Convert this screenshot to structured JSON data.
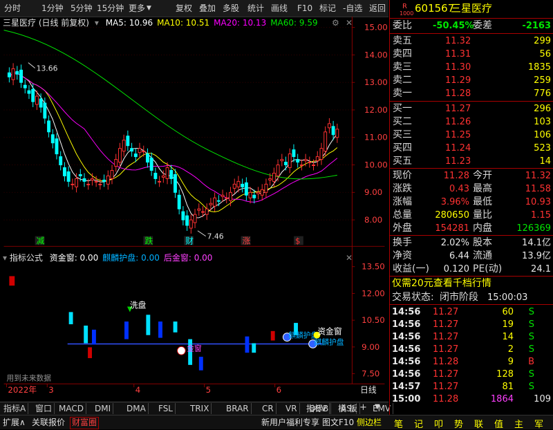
{
  "toolbar": {
    "left_items": [
      "分时",
      "1分钟",
      "5分钟",
      "15分钟",
      "更多"
    ],
    "right_items": [
      "复权",
      "叠加",
      "多股",
      "统计",
      "画线",
      "F10",
      "标记",
      "-自选",
      "返回"
    ]
  },
  "chart": {
    "title": "三星医疗 (日线 前复权)",
    "ma_labels": [
      {
        "text": "MA5: 10.96",
        "color": "#ffffff"
      },
      {
        "text": "MA10: 10.51",
        "color": "#ffff00"
      },
      {
        "text": "MA20: 10.13",
        "color": "#ff00ff"
      },
      {
        "text": "MA60: 9.59",
        "color": "#00e600"
      }
    ],
    "price_axis": [
      "15.00",
      "14.00",
      "13.00",
      "12.00",
      "11.00",
      "10.00",
      "9.00",
      "8.00"
    ],
    "high_mark": "13.66",
    "low_mark": "7.46",
    "event_labels": [
      {
        "text": "减",
        "color": "#00ff00"
      },
      {
        "text": "跌",
        "color": "#00ff00"
      },
      {
        "text": "财",
        "color": "#00ffff"
      },
      {
        "text": "涨",
        "color": "#ff4040"
      },
      {
        "text": "$",
        "color": "#ff3232"
      }
    ],
    "indicator": {
      "name": "指标公式",
      "fields": [
        {
          "text": "资金窗: 0.00",
          "color": "#ffffff"
        },
        {
          "text": "麒麟护盘: 0.00",
          "color": "#00b0ff"
        },
        {
          "text": "后金窗: 0.00",
          "color": "#ff40ff"
        }
      ],
      "axis": [
        "13.50",
        "12.00",
        "10.50",
        "9.00",
        "7.50"
      ],
      "labels": {
        "xipan": "洗盘",
        "jinchuang": "金窗",
        "zijinchuang": "资金窗",
        "qilin1": "麒麟护盘",
        "qilin2": "麒麟护盘"
      },
      "watermark": "用到未来数据"
    },
    "date_axis": [
      "2022年",
      "3",
      "4",
      "5",
      "6"
    ],
    "period": "日线"
  },
  "tabs": [
    "指标A",
    "窗口",
    "MACD",
    "DMI",
    "DMA",
    "FSL",
    "TRIX",
    "BRAR",
    "CR",
    "VR",
    "OBV",
    "ASI",
    "EMV",
    "指标B",
    "模 板"
  ],
  "statusbar": {
    "left": [
      "扩展∧",
      "关联报价",
      "财富圈"
    ],
    "right": [
      "新用户福利专享",
      "图文F10",
      "侧边栏"
    ],
    "icons": [
      "笔",
      "记",
      "叩",
      "势",
      "联",
      "值",
      "主",
      "军"
    ]
  },
  "quote": {
    "badge": "R",
    "badge_sub": "1000",
    "code": "601567",
    "name": "三星医疗",
    "weibi_label": "委比",
    "weibi": "-50.45%",
    "weicha_label": "委差",
    "weicha": "-2163",
    "sells": [
      {
        "label": "卖五",
        "price": "11.32",
        "vol": "299"
      },
      {
        "label": "卖四",
        "price": "11.31",
        "vol": "56"
      },
      {
        "label": "卖三",
        "price": "11.30",
        "vol": "1835"
      },
      {
        "label": "卖二",
        "price": "11.29",
        "vol": "259"
      },
      {
        "label": "卖一",
        "price": "11.28",
        "vol": "776"
      }
    ],
    "buys": [
      {
        "label": "买一",
        "price": "11.27",
        "vol": "296"
      },
      {
        "label": "买二",
        "price": "11.26",
        "vol": "103"
      },
      {
        "label": "买三",
        "price": "11.25",
        "vol": "106"
      },
      {
        "label": "买四",
        "price": "11.24",
        "vol": "523"
      },
      {
        "label": "买五",
        "price": "11.23",
        "vol": "14"
      }
    ],
    "stats": [
      {
        "l1": "现价",
        "v1": "11.28",
        "c1": "#ff3232",
        "l2": "今开",
        "v2": "11.32",
        "c2": "#ff3232"
      },
      {
        "l1": "涨跌",
        "v1": "0.43",
        "c1": "#ff3232",
        "l2": "最高",
        "v2": "11.58",
        "c2": "#ff3232"
      },
      {
        "l1": "涨幅",
        "v1": "3.96%",
        "c1": "#ff3232",
        "l2": "最低",
        "v2": "10.93",
        "c2": "#ff3232"
      },
      {
        "l1": "总量",
        "v1": "280650",
        "c1": "#ffff00",
        "l2": "量比",
        "v2": "1.15",
        "c2": "#ff3232"
      },
      {
        "l1": "外盘",
        "v1": "154281",
        "c1": "#ff3232",
        "l2": "内盘",
        "v2": "126369",
        "c2": "#00e600"
      }
    ],
    "stats2": [
      {
        "l1": "换手",
        "v1": "2.02%",
        "l2": "股本",
        "v2": "14.1亿"
      },
      {
        "l1": "净资",
        "v1": "6.44",
        "l2": "流通",
        "v2": "13.9亿"
      },
      {
        "l1": "收益(一)",
        "v1": "0.120",
        "l2": "PE(动)",
        "v2": "24.1"
      }
    ],
    "promo": "仅需20元查看千档行情",
    "trade_status_label": "交易状态:",
    "trade_status": "闭市阶段",
    "trade_time": "15:00:03",
    "ticks": [
      {
        "t": "14:56",
        "p": "11.27",
        "v": "60",
        "s": "S"
      },
      {
        "t": "14:56",
        "p": "11.27",
        "v": "19",
        "s": "S"
      },
      {
        "t": "14:56",
        "p": "11.27",
        "v": "14",
        "s": "S"
      },
      {
        "t": "14:56",
        "p": "11.27",
        "v": "2",
        "s": "S"
      },
      {
        "t": "14:56",
        "p": "11.28",
        "v": "9",
        "s": "B"
      },
      {
        "t": "14:56",
        "p": "11.27",
        "v": "128",
        "s": "S"
      },
      {
        "t": "14:57",
        "p": "11.27",
        "v": "81",
        "s": "S"
      },
      {
        "t": "15:00",
        "p": "11.28",
        "v": "1864",
        "s": "109"
      }
    ]
  },
  "colors": {
    "up": "#ff3232",
    "down": "#00ffff",
    "ma5": "#ffffff",
    "ma10": "#ffff00",
    "ma20": "#ff00ff",
    "ma60": "#00e600",
    "grid": "#8b0000"
  }
}
